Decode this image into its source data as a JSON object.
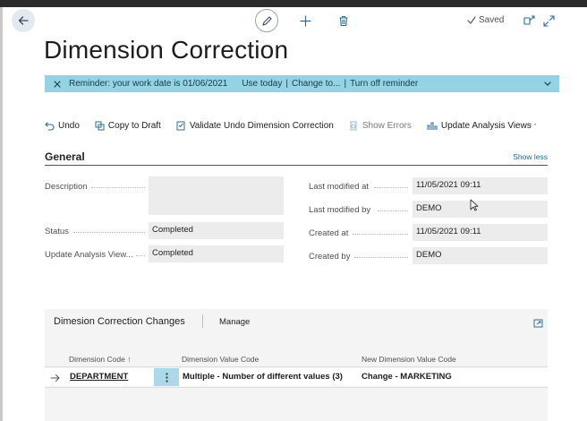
{
  "header": {
    "saved_label": "Saved"
  },
  "page": {
    "title": "Dimension Correction"
  },
  "reminder": {
    "message": "Reminder: your work date is 01/06/2021",
    "links": [
      "Use today",
      "Change to...",
      "Turn off reminder"
    ],
    "separator": "|"
  },
  "actions": [
    {
      "label": "Undo",
      "icon": "undo-icon"
    },
    {
      "label": "Copy to Draft",
      "icon": "copy-icon"
    },
    {
      "label": "Validate Undo Dimension Correction",
      "icon": "validate-icon"
    },
    {
      "label": "Show Errors",
      "icon": "errors-icon",
      "disabled": true
    },
    {
      "label": "Update Analysis Views",
      "icon": "analysis-icon"
    }
  ],
  "more_label": "···",
  "general": {
    "title": "General",
    "show_less": "Show less",
    "left_fields": [
      {
        "label": "Description",
        "value": ""
      },
      {
        "label": "Status",
        "value": "Completed"
      },
      {
        "label": "Update Analysis View...",
        "value": "Completed"
      }
    ],
    "right_fields": [
      {
        "label": "Last modified at",
        "value": "11/05/2021 09:11"
      },
      {
        "label": "Last modified by",
        "value": "DEMO"
      },
      {
        "label": "Created at",
        "value": "11/05/2021 09:11"
      },
      {
        "label": "Created by",
        "value": "DEMO"
      }
    ]
  },
  "changes": {
    "title": "Dimesion Correction Changes",
    "manage": "Manage",
    "columns": [
      "Dimension Code ↑",
      "Dimension Value Code",
      "New Dimension Value Code"
    ],
    "rows": [
      {
        "dimension_code": "DEPARTMENT",
        "dimension_value_code": "Multiple - Number of different values (3)",
        "new_dimension_value_code": "Change - MARKETING"
      }
    ]
  },
  "colors": {
    "reminder_bg": "#93d3e4",
    "row_menu_bg": "#add8e9",
    "link": "#1f6c8f"
  }
}
